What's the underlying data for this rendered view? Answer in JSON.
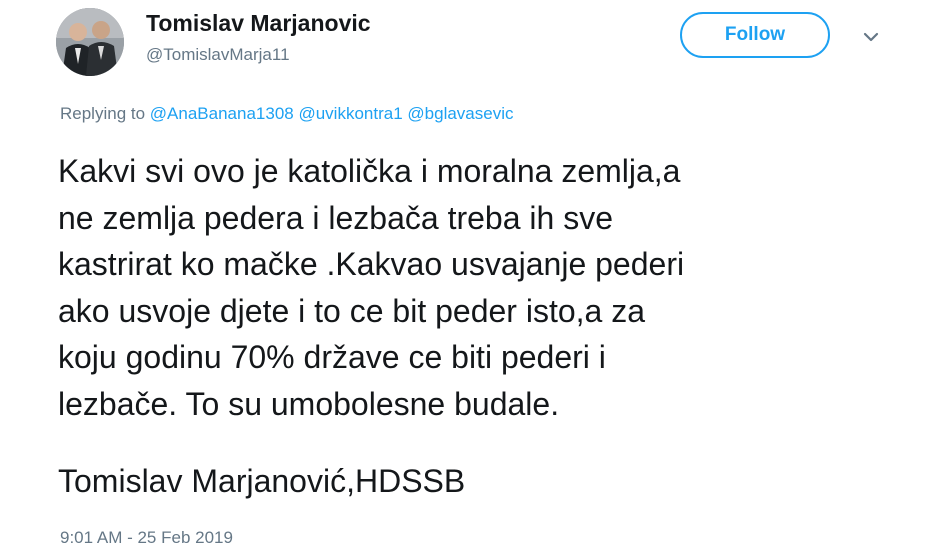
{
  "author": {
    "display_name": "Tomislav Marjanovic",
    "handle": "@TomislavMarja11",
    "avatar_icon": "profile-photo-two-men-in-suits"
  },
  "follow_label": "Follow",
  "colors": {
    "accent": "#1da1f2",
    "text": "#14171a",
    "muted": "#657786"
  },
  "replying": {
    "prefix": "Replying to",
    "mentions": [
      "@AnaBanana1308",
      "@uvikkontra1",
      "@bglavasevic"
    ]
  },
  "tweet": {
    "lines": [
      "Kakvi svi ovo je katolička i moralna zemlja,a",
      "ne zemlja pedera i lezbača treba ih sve",
      "kastrirat ko mačke .Kakvao usvajanje pederi",
      "ako usvoje djete i to ce bit peder isto,a za",
      "koju godinu 70% države ce biti pederi i",
      "lezbače. To su umobolesne budale."
    ],
    "signature": "Tomislav Marjanović,HDSSB"
  },
  "timestamp": "9:01 AM - 25 Feb 2019"
}
